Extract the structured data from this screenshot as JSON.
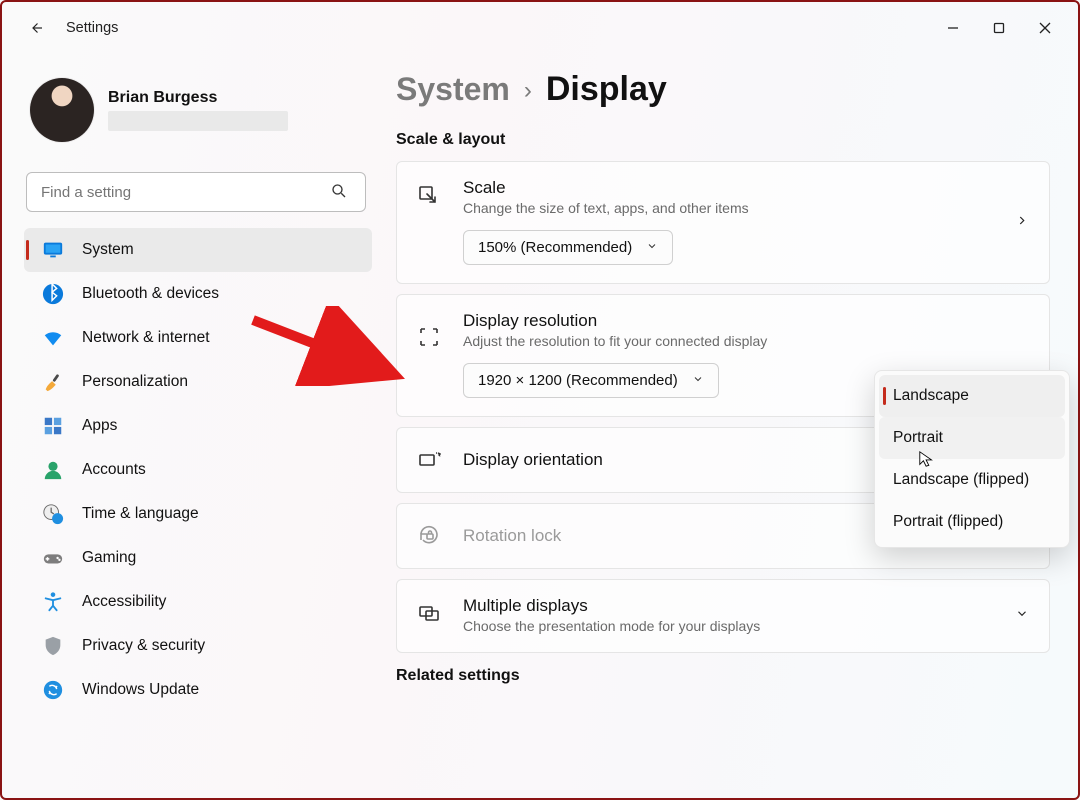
{
  "titlebar": {
    "app_title": "Settings"
  },
  "user": {
    "name": "Brian Burgess"
  },
  "search": {
    "placeholder": "Find a setting"
  },
  "nav": {
    "items": [
      {
        "label": "System",
        "icon": "monitor",
        "selected": true
      },
      {
        "label": "Bluetooth & devices",
        "icon": "bluetooth"
      },
      {
        "label": "Network & internet",
        "icon": "wifi"
      },
      {
        "label": "Personalization",
        "icon": "brush"
      },
      {
        "label": "Apps",
        "icon": "apps"
      },
      {
        "label": "Accounts",
        "icon": "person"
      },
      {
        "label": "Time & language",
        "icon": "clock-globe"
      },
      {
        "label": "Gaming",
        "icon": "gamepad"
      },
      {
        "label": "Accessibility",
        "icon": "accessibility"
      },
      {
        "label": "Privacy & security",
        "icon": "shield"
      },
      {
        "label": "Windows Update",
        "icon": "sync"
      }
    ]
  },
  "breadcrumb": {
    "root": "System",
    "leaf": "Display"
  },
  "section_scale_layout": "Scale & layout",
  "scale_card": {
    "title": "Scale",
    "sub": "Change the size of text, apps, and other items",
    "value": "150% (Recommended)"
  },
  "resolution_card": {
    "title": "Display resolution",
    "sub": "Adjust the resolution to fit your connected display",
    "value": "1920 × 1200 (Recommended)"
  },
  "orientation_row": {
    "title": "Display orientation"
  },
  "rotation_row": {
    "title": "Rotation lock"
  },
  "multiple_card": {
    "title": "Multiple displays",
    "sub": "Choose the presentation mode for your displays"
  },
  "related_heading": "Related settings",
  "orientation_options": {
    "items": [
      "Landscape",
      "Portrait",
      "Landscape (flipped)",
      "Portrait (flipped)"
    ],
    "selected_index": 0,
    "hover_index": 1
  }
}
